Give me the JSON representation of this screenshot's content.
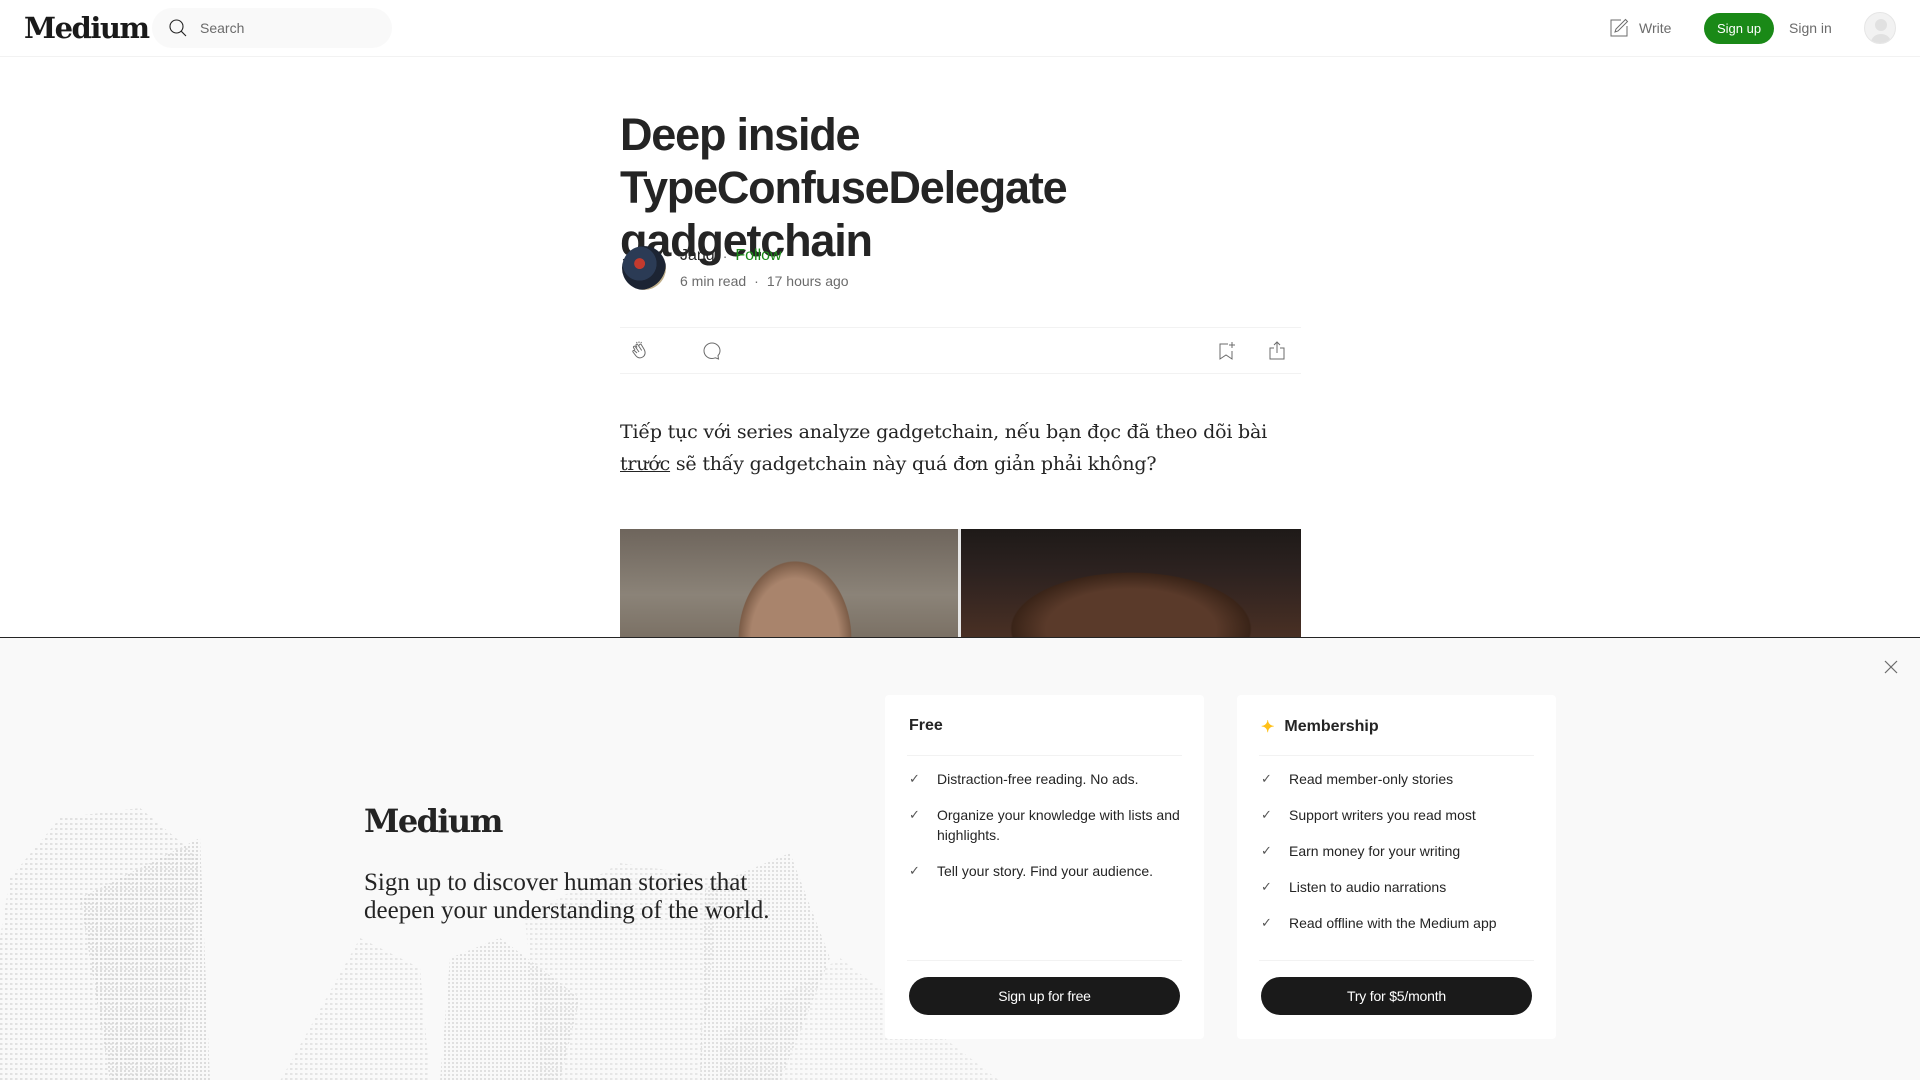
{
  "header": {
    "logo": "Medium",
    "search_placeholder": "Search",
    "write_label": "Write",
    "signup_label": "Sign up",
    "signin_label": "Sign in",
    "brand_green": "#1a8917"
  },
  "article": {
    "title": "Deep inside TypeConfuseDelegate gadgetchain",
    "author": {
      "name": "Jang",
      "separator": "·",
      "follow_label": "Follow",
      "read_time": "6 min read",
      "published": "17 hours ago"
    },
    "actions": [
      "clap-icon",
      "comment-icon",
      "bookmark-add-icon",
      "share-icon"
    ],
    "paragraph": {
      "before_link": "Tiếp tục với series analyze gadgetchain, nếu bạn đọc đã theo dõi bài ",
      "link_text": "trước",
      "after_link": " sẽ thấy gadgetchain này quá đơn giản phải không?"
    }
  },
  "overlay": {
    "logo": "Medium",
    "tagline": "Sign up to discover human stories that deepen your understanding of the world.",
    "plans": [
      {
        "title": "Free",
        "features": [
          "Distraction-free reading. No ads.",
          "Organize your knowledge with lists and highlights.",
          "Tell your story. Find your audience."
        ],
        "cta": "Sign up for free"
      },
      {
        "title": "Membership",
        "star_color": "#ffc017",
        "features": [
          "Read member-only stories",
          "Support writers you read most",
          "Earn money for your writing",
          "Listen to audio narrations",
          "Read offline with the Medium app"
        ],
        "cta": "Try for $5/month"
      }
    ]
  }
}
